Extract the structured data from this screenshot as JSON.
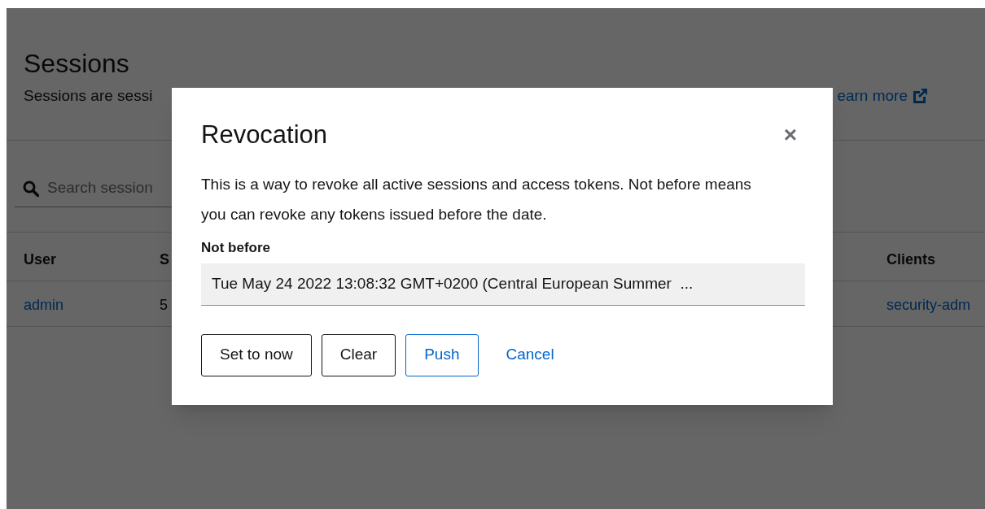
{
  "page": {
    "title": "Sessions",
    "description": "Sessions are sessi",
    "learn_more": "earn more",
    "search": {
      "placeholder": "Search session"
    }
  },
  "table": {
    "columns": [
      "User",
      "S",
      "Clients"
    ],
    "rows": [
      {
        "cells": [
          "admin",
          "5",
          "security-adm"
        ]
      }
    ]
  },
  "dialog": {
    "title": "Revocation",
    "close": "×",
    "text": "This is a way to revoke all active sessions and access tokens. Not before means you can revoke any tokens issued before the date.",
    "field": {
      "label": "Not before",
      "value": "Tue May 24 2022 13:08:32 GMT+0200 (Central European Summer  ..."
    },
    "buttons": [
      {
        "label": "Set to now",
        "kind": "secondary"
      },
      {
        "label": "Clear",
        "kind": "secondary"
      },
      {
        "label": "Push",
        "kind": "primary"
      },
      {
        "label": "Cancel",
        "kind": "link"
      }
    ]
  }
}
